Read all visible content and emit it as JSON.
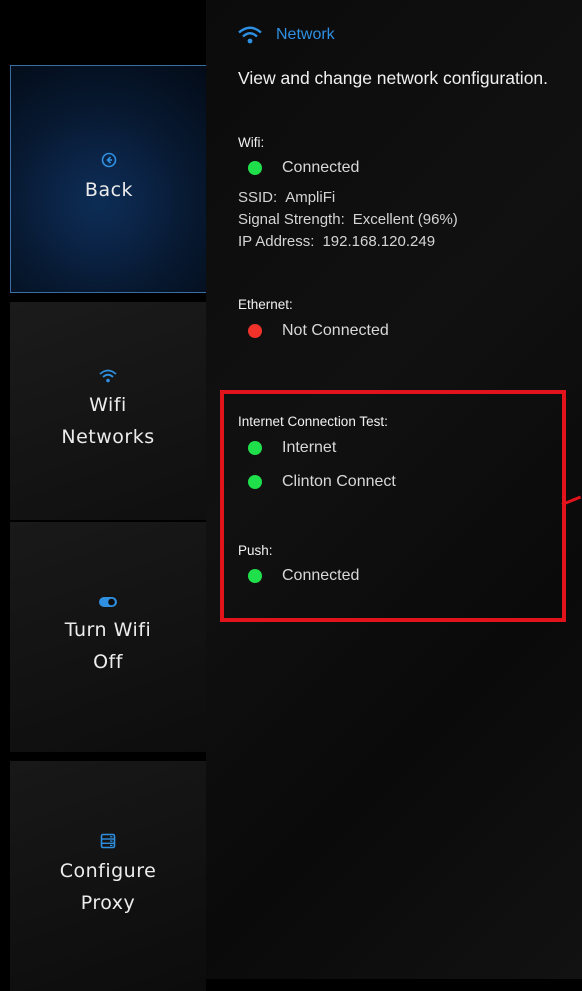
{
  "sidebar": {
    "back": {
      "label": "Back",
      "icon": "back-circle-icon"
    },
    "wifi_networks": {
      "label": "Wifi\nNetworks",
      "icon": "wifi-icon"
    },
    "turn_wifi_off": {
      "label": "Turn Wifi\nOff",
      "icon": "toggle-icon"
    },
    "configure_proxy": {
      "label": "Configure\nProxy",
      "icon": "server-icon"
    }
  },
  "header": {
    "title": "Network",
    "icon": "wifi-icon"
  },
  "subtitle": "View and change network configuration.",
  "wifi": {
    "label": "Wifi:",
    "status": "Connected",
    "ssid_key": "SSID:",
    "ssid": "AmpliFi",
    "signal_key": "Signal Strength:",
    "signal": "Excellent (96%)",
    "ip_key": "IP Address:",
    "ip": "192.168.120.249"
  },
  "ethernet": {
    "label": "Ethernet:",
    "status": "Not Connected"
  },
  "internet_test": {
    "label": "Internet Connection Test:",
    "items": [
      "Internet",
      "Clinton Connect"
    ]
  },
  "push": {
    "label": "Push:",
    "status": "Connected"
  },
  "colors": {
    "accent": "#2f8fe0",
    "ok": "#1fe04a",
    "error": "#f0322a",
    "highlight": "#e3131b"
  }
}
